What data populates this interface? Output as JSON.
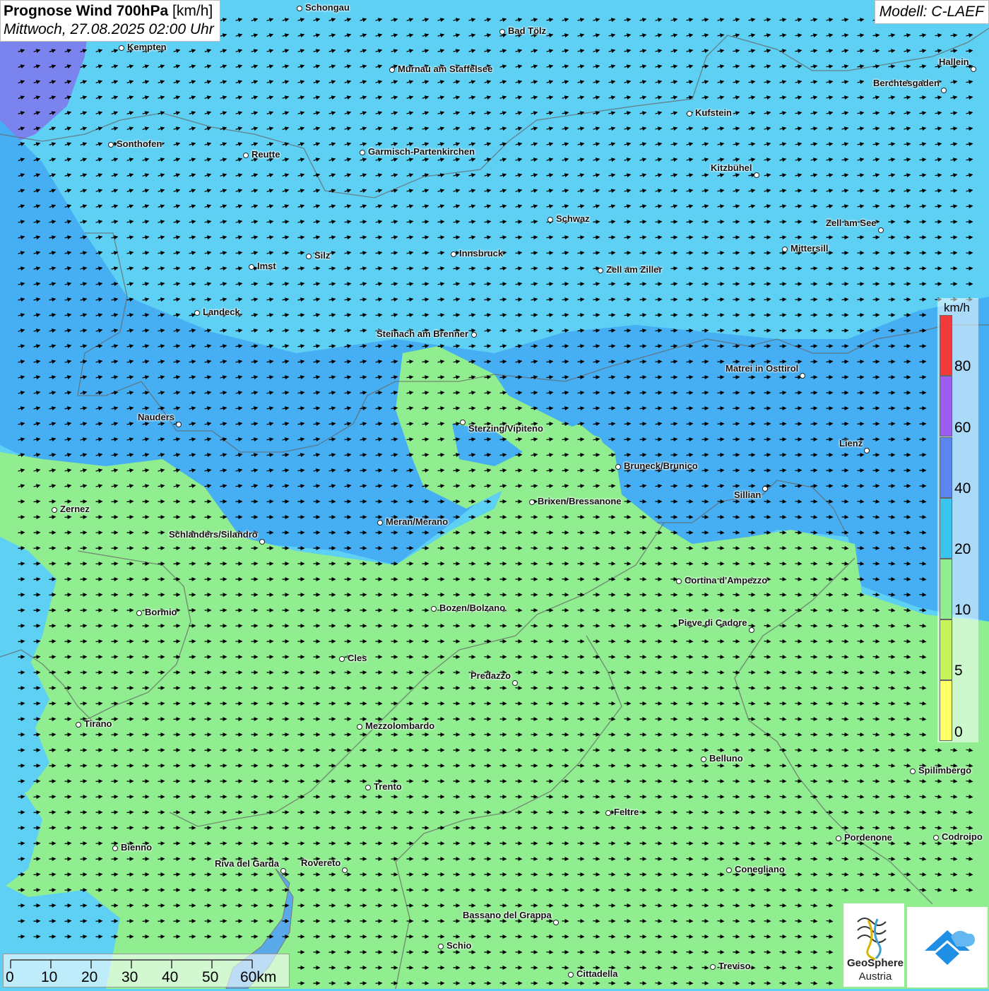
{
  "title": {
    "bold": "Prognose Wind 700hPa",
    "unit": "[km/h]",
    "date": "Mittwoch, 27.08.2025 02:00 Uhr"
  },
  "model": "Modell: C-LAEF",
  "legend": {
    "unit": "km/h",
    "labels": [
      "80",
      "60",
      "40",
      "20",
      "10",
      "5",
      "0"
    ],
    "colors": [
      "#f23a3a",
      "#9b5cf0",
      "#5b86f2",
      "#3cc4f0",
      "#90ee90",
      "#c6f25a",
      "#ffff66"
    ]
  },
  "scale": {
    "labels": [
      "0",
      "10",
      "20",
      "30",
      "40",
      "50",
      "60km"
    ]
  },
  "logos": {
    "geosphere_line1": "GeoSphere",
    "geosphere_line2": "Austria"
  },
  "colors": {
    "blue_zone": "#5ed0f4",
    "light_blue": "#46aef2",
    "green_zone": "#90ee90",
    "purple_zone": "#7b84ee"
  },
  "cities": [
    {
      "name": "Schongau"
    },
    {
      "name": "Bad Tölz"
    },
    {
      "name": "Kempten"
    },
    {
      "name": "Hallein"
    },
    {
      "name": "Murnau am Staffelsee"
    },
    {
      "name": "Berchtesgaden"
    },
    {
      "name": "Kufstein"
    },
    {
      "name": "Sonthofen"
    },
    {
      "name": "Reutte"
    },
    {
      "name": "Garmisch-Partenkirchen"
    },
    {
      "name": "Kitzbühel"
    },
    {
      "name": "Schwaz"
    },
    {
      "name": "Zell am See"
    },
    {
      "name": "Mittersill"
    },
    {
      "name": "Innsbruck"
    },
    {
      "name": "Silz"
    },
    {
      "name": "Imst"
    },
    {
      "name": "Zell am Ziller"
    },
    {
      "name": "Landeck"
    },
    {
      "name": "Steinach am Brenner"
    },
    {
      "name": "Matrei in Osttirol"
    },
    {
      "name": "Nauders"
    },
    {
      "name": "Sterzing/Vipiteno"
    },
    {
      "name": "Lienz"
    },
    {
      "name": "Bruneck/Brunico"
    },
    {
      "name": "Sillian"
    },
    {
      "name": "Brixen/Bressanone"
    },
    {
      "name": "Zernez"
    },
    {
      "name": "Meran/Merano"
    },
    {
      "name": "Schlanders/Silandro"
    },
    {
      "name": "Cortina d'Ampezzo"
    },
    {
      "name": "Bozen/Bolzano"
    },
    {
      "name": "Bormio"
    },
    {
      "name": "Pieve di Cadore"
    },
    {
      "name": "Cles"
    },
    {
      "name": "Predazzo"
    },
    {
      "name": "Tirano"
    },
    {
      "name": "Mezzolombardo"
    },
    {
      "name": "Belluno"
    },
    {
      "name": "Spilimbergo"
    },
    {
      "name": "Trento"
    },
    {
      "name": "Feltre"
    },
    {
      "name": "Pordenone"
    },
    {
      "name": "Codroipo"
    },
    {
      "name": "Bienno"
    },
    {
      "name": "Riva del Garda"
    },
    {
      "name": "Rovereto"
    },
    {
      "name": "Conegliano"
    },
    {
      "name": "Bassano del Grappa"
    },
    {
      "name": "Schio"
    },
    {
      "name": "Treviso"
    },
    {
      "name": "Cittadella"
    }
  ]
}
